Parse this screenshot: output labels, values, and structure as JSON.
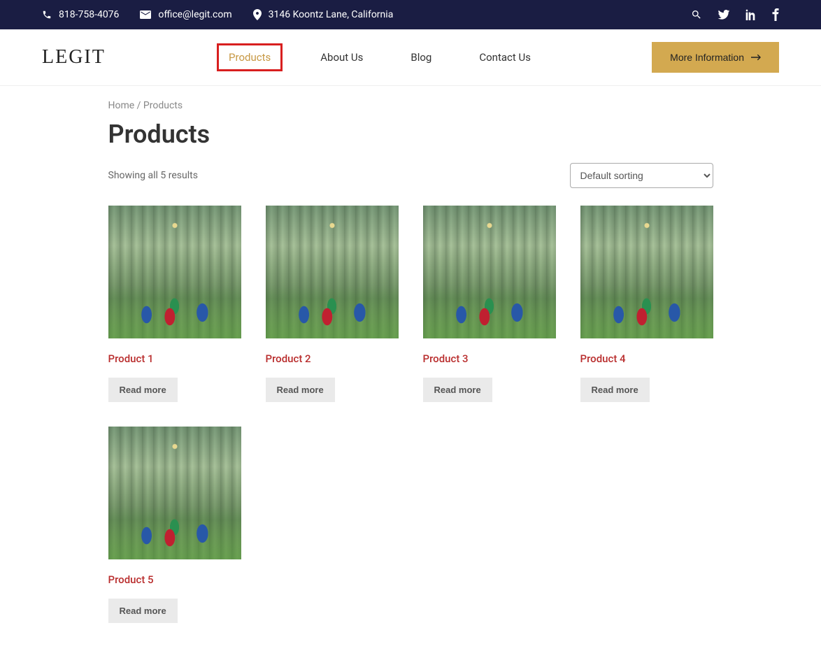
{
  "topbar": {
    "phone": "818-758-4076",
    "email": "office@legit.com",
    "address": "3146 Koontz Lane, California"
  },
  "brand": "LEGIT",
  "nav": {
    "items": [
      {
        "label": "Products",
        "active": true
      },
      {
        "label": "About Us",
        "active": false
      },
      {
        "label": "Blog",
        "active": false
      },
      {
        "label": "Contact Us",
        "active": false
      }
    ],
    "cta": "More Information"
  },
  "breadcrumb": {
    "home": "Home",
    "sep": " / ",
    "current": "Products"
  },
  "page": {
    "title": "Products",
    "result_count": "Showing all 5 results"
  },
  "sort": {
    "selected": "Default sorting"
  },
  "products": [
    {
      "title": "Product 1",
      "button": "Read more"
    },
    {
      "title": "Product 2",
      "button": "Read more"
    },
    {
      "title": "Product 3",
      "button": "Read more"
    },
    {
      "title": "Product 4",
      "button": "Read more"
    },
    {
      "title": "Product 5",
      "button": "Read more"
    }
  ]
}
